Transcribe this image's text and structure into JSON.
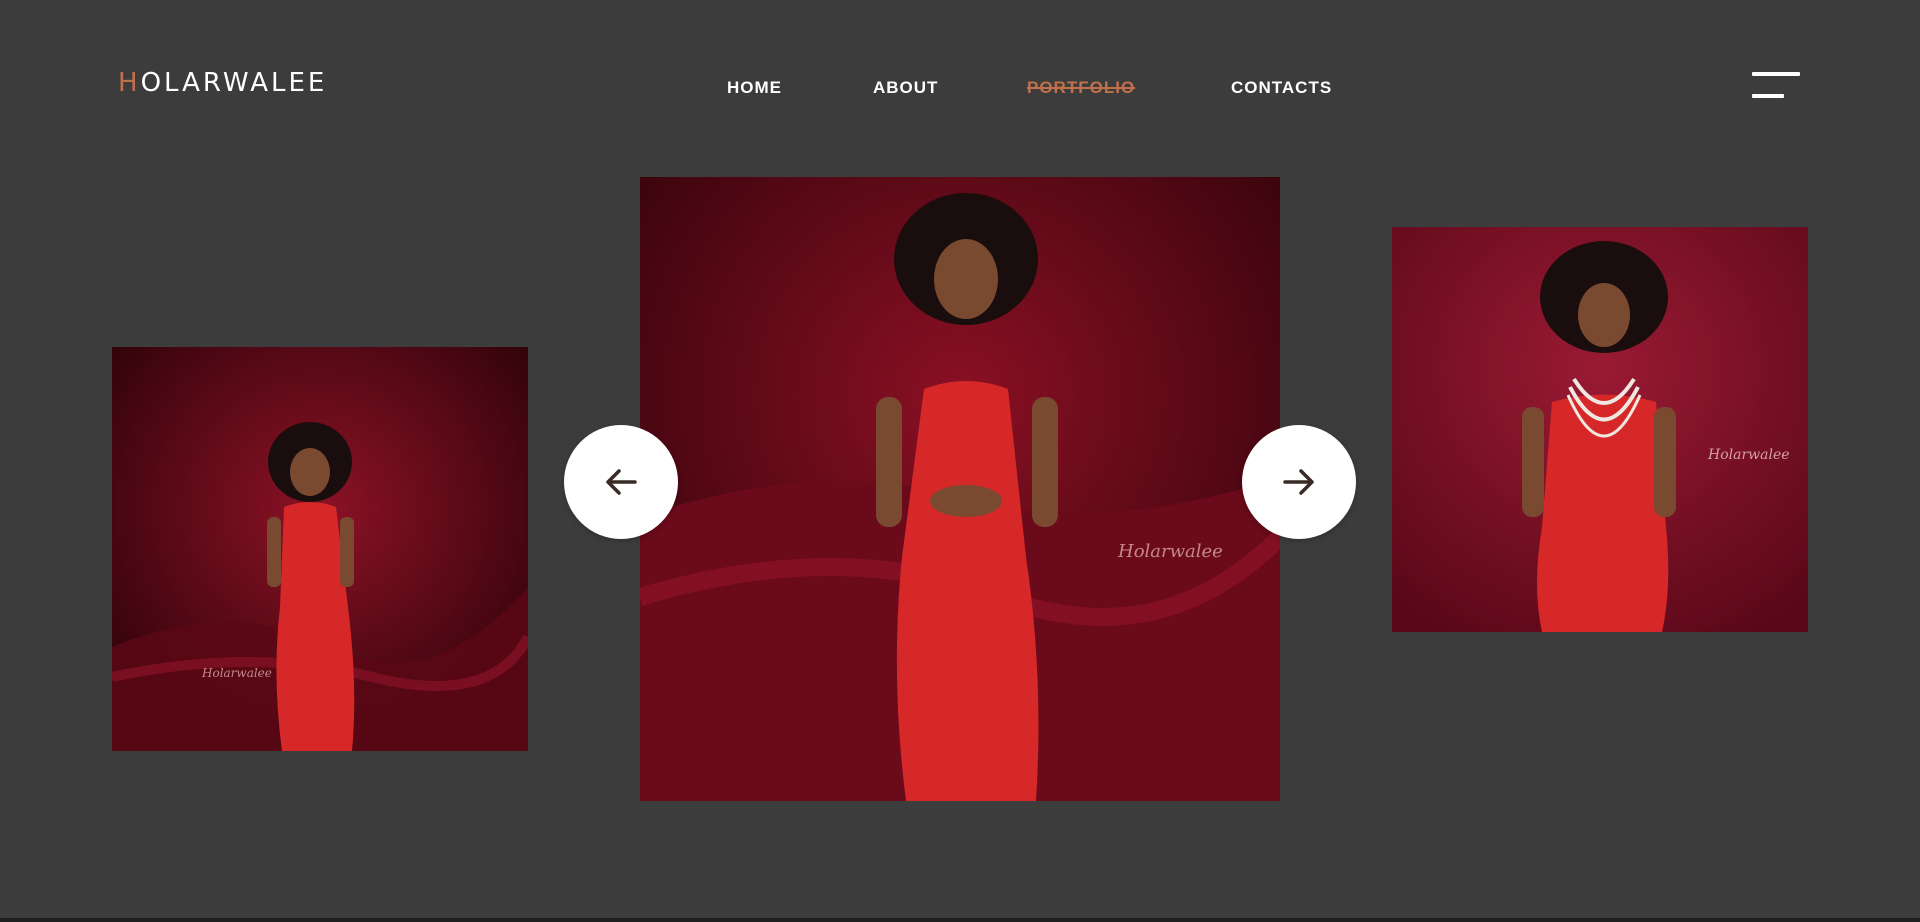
{
  "brand": {
    "logo_initial": "H",
    "logo_rest": "OLARWALEE",
    "accent_color": "#c0704a"
  },
  "nav": {
    "items": [
      {
        "label": "HOME",
        "active": false
      },
      {
        "label": "ABOUT",
        "active": false
      },
      {
        "label": "PORTFOLIO",
        "active": true
      },
      {
        "label": "CONTACTS",
        "active": false
      }
    ]
  },
  "menu": {
    "icon": "hamburger-menu-icon"
  },
  "carousel": {
    "slides": [
      {
        "watermark": "Holarwalee",
        "subject": "woman in red satin dress laughing, fabric flowing"
      },
      {
        "watermark": "Holarwalee",
        "subject": "woman in red satin dress smiling, hands clasped"
      },
      {
        "watermark": "Holarwalee",
        "subject": "woman in red dress with pearl necklaces, crouching"
      }
    ],
    "prev_icon": "arrow-left-icon",
    "next_icon": "arrow-right-icon"
  },
  "colors": {
    "background": "#3c3c3c",
    "photo_backdrop": "#7a0f22",
    "dress_red": "#d62828"
  }
}
